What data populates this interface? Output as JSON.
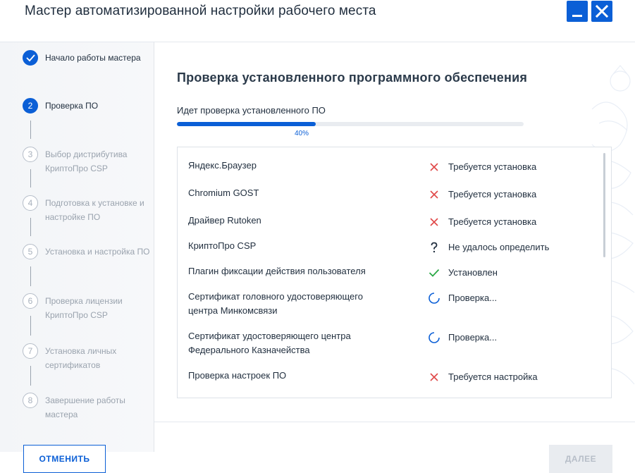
{
  "window": {
    "title": "Мастер автоматизированной настройки рабочего места",
    "accent_color": "#0b5fd6"
  },
  "steps": [
    {
      "number": "",
      "label": "Начало работы мастера",
      "state": "done"
    },
    {
      "number": "2",
      "label": "Проверка ПО",
      "state": "active"
    },
    {
      "number": "3",
      "label": "Выбор дистрибутива КриптоПро CSP",
      "state": "pending"
    },
    {
      "number": "4",
      "label": "Подготовка к установке и настройке ПО",
      "state": "pending"
    },
    {
      "number": "5",
      "label": "Установка и настройка ПО",
      "state": "pending"
    },
    {
      "number": "6",
      "label": "Проверка лицензии КриптоПро CSP",
      "state": "pending"
    },
    {
      "number": "7",
      "label": "Установка личных сертификатов",
      "state": "pending"
    },
    {
      "number": "8",
      "label": "Завершение работы мастера",
      "state": "pending"
    }
  ],
  "main": {
    "title": "Проверка установленного программного обеспечения",
    "progress_label": "Идет проверка установленного ПО",
    "progress_value": 0.4,
    "progress_text": "40%"
  },
  "checks": [
    {
      "name": "Яндекс.Браузер",
      "status": "Требуется установка",
      "icon": "cross-icon"
    },
    {
      "name": "Chromium GOST",
      "status": "Требуется установка",
      "icon": "cross-icon"
    },
    {
      "name": "Драйвер Rutoken",
      "status": "Требуется установка",
      "icon": "cross-icon"
    },
    {
      "name": "КриптоПро CSP",
      "status": "Не удалось определить",
      "icon": "question-icon"
    },
    {
      "name": "Плагин фиксации действия пользователя",
      "status": "Установлен",
      "icon": "check-icon"
    },
    {
      "name": "Сертификат головного удостоверяющего центра Минкомсвязи",
      "status": "Проверка...",
      "icon": "spinner-icon"
    },
    {
      "name": "Сертификат удостоверяющего центра Федерального Казначейства",
      "status": "Проверка...",
      "icon": "spinner-icon"
    },
    {
      "name": "Проверка настроек ПО",
      "status": "Требуется настройка",
      "icon": "cross-icon"
    }
  ],
  "footer": {
    "cancel_label": "ОТМЕНИТЬ",
    "next_label": "ДАЛЕЕ"
  }
}
